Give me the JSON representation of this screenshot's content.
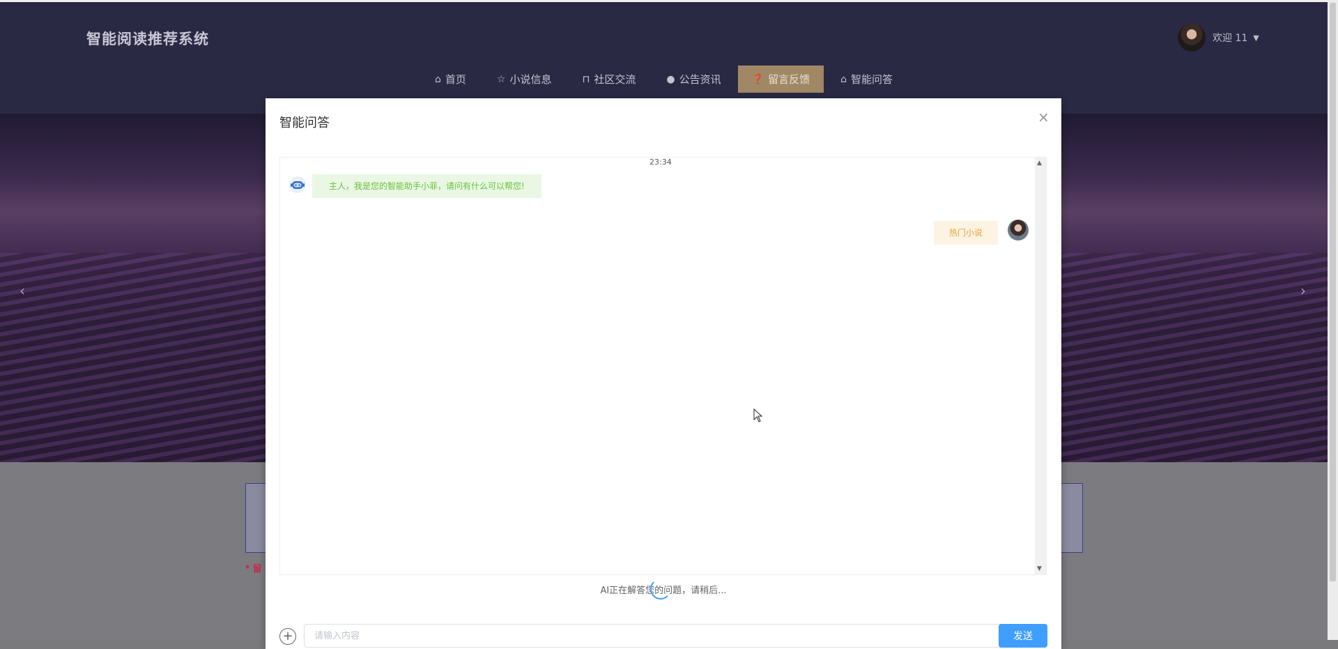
{
  "header": {
    "brand": "智能阅读推荐系统",
    "welcome": "欢迎 11",
    "caret": "▼"
  },
  "nav": {
    "items": [
      {
        "label": "首页",
        "icon": "home-icon",
        "glyph": "⌂"
      },
      {
        "label": "小说信息",
        "icon": "star-icon",
        "glyph": "☆"
      },
      {
        "label": "社区交流",
        "icon": "bag-icon",
        "glyph": "⊓"
      },
      {
        "label": "公告资讯",
        "icon": "info-icon",
        "glyph": "●"
      },
      {
        "label": "留言反馈",
        "icon": "question-icon",
        "glyph": "❓",
        "active": true
      },
      {
        "label": "智能问答",
        "icon": "home-icon",
        "glyph": "⌂"
      }
    ]
  },
  "banner": {
    "prev": "‹",
    "next": "›"
  },
  "lower": {
    "required_label": "* 留"
  },
  "modal": {
    "title": "智能问答",
    "close": "×",
    "time": "23:34",
    "bot_message": "主人，我是您的智能助手小菲，请问有什么可以帮您!",
    "user_message": "热门小说",
    "status": "AI正在解答您的问题，请稍后...",
    "input_placeholder": "请输入内容",
    "send_label": "发送",
    "plus": "+"
  },
  "colors": {
    "accent": "#409eff",
    "active_nav": "#a08866",
    "bot_text": "#67c23a",
    "user_text": "#e6a23c"
  }
}
